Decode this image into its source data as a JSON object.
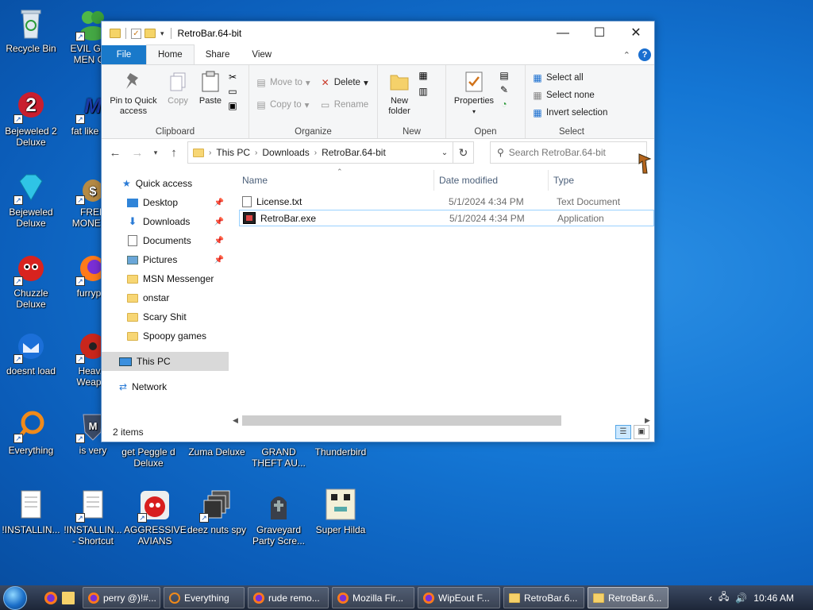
{
  "desktop": {
    "icons": [
      {
        "label": "Recycle Bin"
      },
      {
        "label": "EVIL GR... MEN C..."
      },
      {
        "label": "Bejeweled 2 Deluxe"
      },
      {
        "label": "fat like d..."
      },
      {
        "label": "Bejeweled Deluxe"
      },
      {
        "label": "FREE MONEY..."
      },
      {
        "label": "Chuzzle Deluxe"
      },
      {
        "label": "furryp..."
      },
      {
        "label": "doesnt load"
      },
      {
        "label": "Heav... Weap..."
      },
      {
        "label": "Everything"
      },
      {
        "label": "is very"
      },
      {
        "label": "get Peggle d Deluxe"
      },
      {
        "label": "Zuma Deluxe"
      },
      {
        "label": "GRAND THEFT AU..."
      },
      {
        "label": "Thunderbird"
      },
      {
        "label": "!INSTALLIN..."
      },
      {
        "label": "!INSTALLIN... - Shortcut"
      },
      {
        "label": "AGGRESSIVE AVIANS"
      },
      {
        "label": "deez nuts spy"
      },
      {
        "label": "Graveyard Party Scre..."
      },
      {
        "label": "Super Hilda"
      }
    ]
  },
  "window": {
    "title": "RetroBar.64-bit",
    "controls": {
      "minimize": "—",
      "maximize": "☐",
      "close": "✕"
    },
    "tabs": {
      "file": "File",
      "home": "Home",
      "share": "Share",
      "view": "View"
    },
    "help": "?",
    "ribbon": {
      "clipboard": {
        "group": "Clipboard",
        "pin": "Pin to Quick access",
        "copy": "Copy",
        "paste": "Paste"
      },
      "organize": {
        "group": "Organize",
        "move_to": "Move to",
        "copy_to": "Copy to",
        "delete": "Delete",
        "rename": "Rename"
      },
      "new": {
        "group": "New",
        "new_folder": "New folder"
      },
      "open": {
        "group": "Open",
        "properties": "Properties"
      },
      "select": {
        "group": "Select",
        "select_all": "Select all",
        "select_none": "Select none",
        "invert": "Invert selection"
      }
    },
    "address": {
      "crumbs": [
        "This PC",
        "Downloads",
        "RetroBar.64-bit"
      ],
      "search_placeholder": "Search RetroBar.64-bit"
    },
    "nav": {
      "quick_access": "Quick access",
      "items": [
        "Desktop",
        "Downloads",
        "Documents",
        "Pictures",
        "MSN Messenger",
        "onstar",
        "Scary Shit",
        "Spoopy games"
      ],
      "this_pc": "This PC",
      "network": "Network"
    },
    "columns": {
      "name": "Name",
      "date": "Date modified",
      "type": "Type"
    },
    "files": [
      {
        "name": "License.txt",
        "date": "5/1/2024 4:34 PM",
        "type": "Text Document"
      },
      {
        "name": "RetroBar.exe",
        "date": "5/1/2024 4:34 PM",
        "type": "Application"
      }
    ],
    "status": "2 items"
  },
  "taskbar": {
    "tasks": [
      {
        "label": "perry @)!#..."
      },
      {
        "label": "Everything"
      },
      {
        "label": "rude remo..."
      },
      {
        "label": "Mozilla Fir..."
      },
      {
        "label": "WipEout F..."
      },
      {
        "label": "RetroBar.6..."
      },
      {
        "label": "RetroBar.6..."
      }
    ],
    "clock": "10:46 AM"
  },
  "colors": {
    "accent": "#1979ca",
    "desktop": "#1476d4",
    "taskbar": "#1d2638"
  }
}
